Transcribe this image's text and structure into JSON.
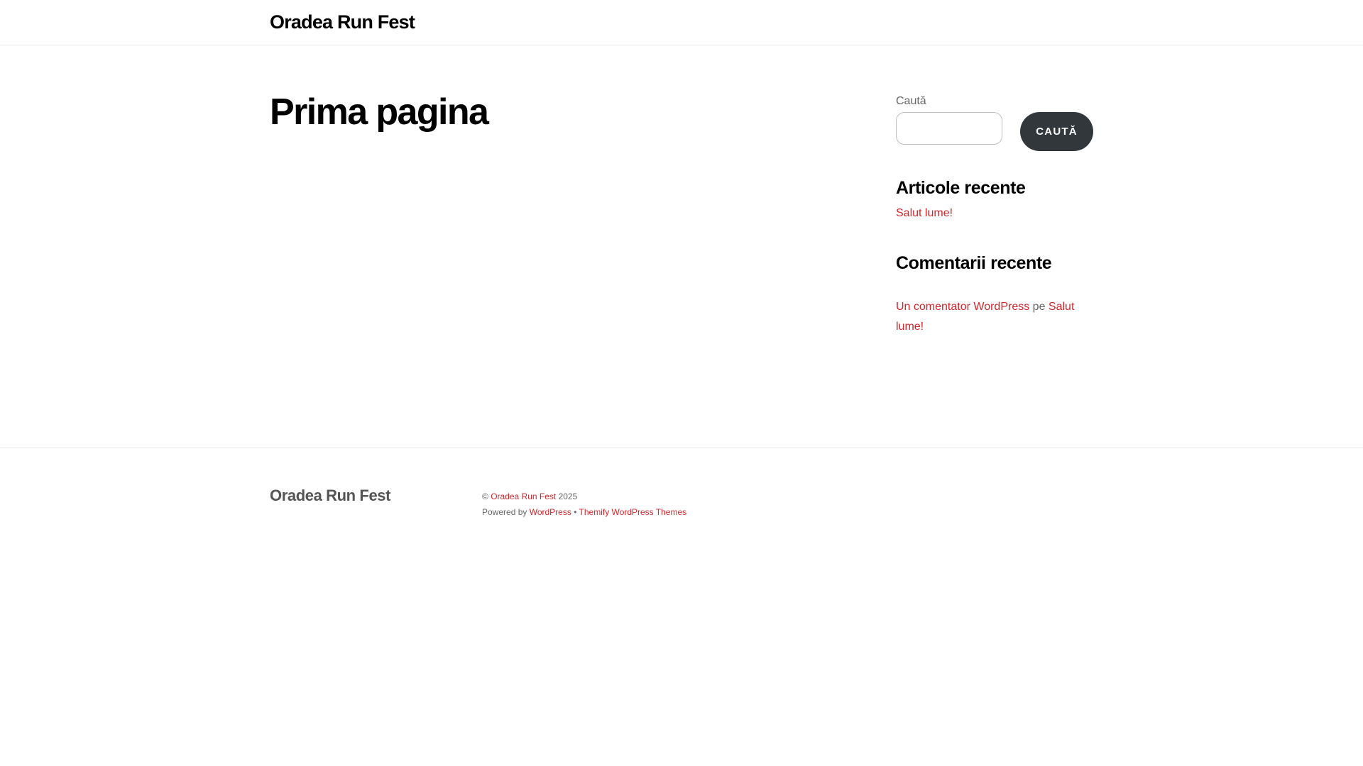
{
  "header": {
    "site_title": "Oradea Run Fest"
  },
  "main": {
    "page_title": "Prima pagina"
  },
  "sidebar": {
    "search": {
      "label": "Caută",
      "input_value": "",
      "button_label": "CAUTĂ"
    },
    "recent_posts": {
      "title": "Articole recente",
      "items": [
        "Salut lume!"
      ]
    },
    "recent_comments": {
      "title": "Comentarii recente",
      "items": [
        {
          "author": "Un comentator WordPress",
          "connector": "pe",
          "post": "Salut lume!"
        }
      ]
    }
  },
  "footer": {
    "site_title": "Oradea Run Fest",
    "copyright_symbol": "©",
    "copyright_link": "Oradea Run Fest",
    "year": "2025",
    "powered_by": "Powered by",
    "wordpress_link": "WordPress",
    "separator": "•",
    "theme_link": "Themify WordPress Themes"
  },
  "colors": {
    "link": "#d0262b",
    "button_bg": "#32373c",
    "border": "#e8e8e8"
  }
}
